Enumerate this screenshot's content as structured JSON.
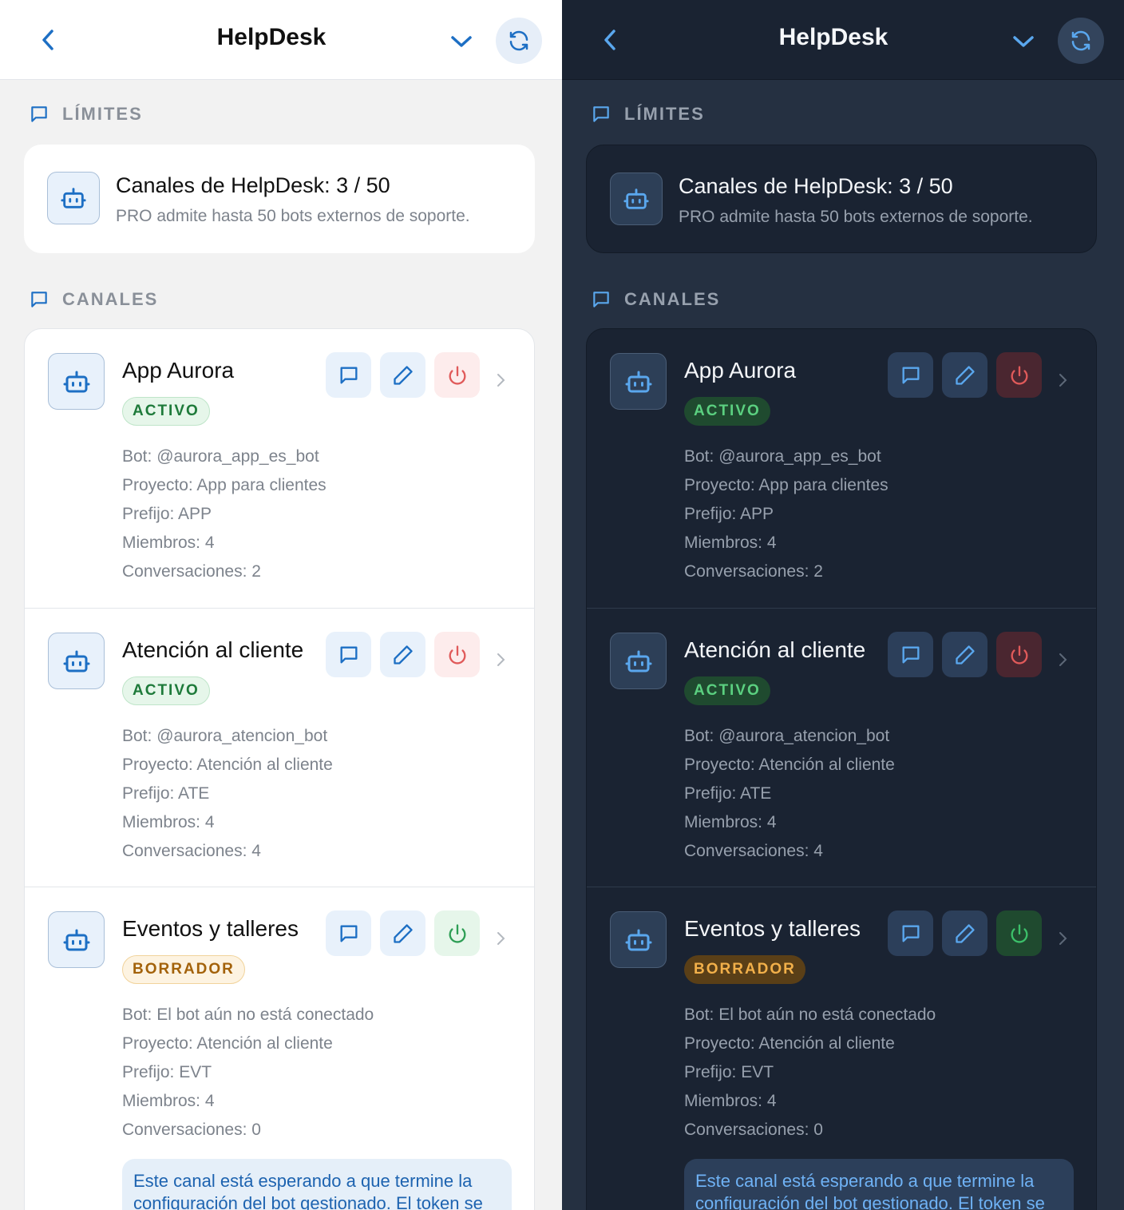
{
  "colors": {
    "accent_light": "#1d6fc4",
    "accent_dark": "#5aa7ee",
    "danger": "#e05a5a",
    "success": "#2e9e55",
    "warning": "#c47c12"
  },
  "header": {
    "title": "HelpDesk",
    "back_icon": "chevron-left-icon",
    "dropdown_icon": "chevron-down-icon",
    "refresh_icon": "refresh-icon"
  },
  "limits": {
    "section_label": "LÍMITES",
    "title": "Canales de HelpDesk: 3 / 50",
    "subtitle": "PRO admite hasta 50 bots externos de soporte."
  },
  "channels_section": {
    "label": "CANALES"
  },
  "channels": [
    {
      "name": "App Aurora",
      "status": "ACTIVO",
      "bot": "Bot: @aurora_app_es_bot",
      "project": "Proyecto: App para clientes",
      "prefix": "Prefijo: APP",
      "members": "Miembros: 4",
      "conversations": "Conversaciones: 2"
    },
    {
      "name": "Atención al cliente",
      "status": "ACTIVO",
      "bot": "Bot: @aurora_atencion_bot",
      "project": "Proyecto: Atención al cliente",
      "prefix": "Prefijo: ATE",
      "members": "Miembros: 4",
      "conversations": "Conversaciones: 4"
    },
    {
      "name": "Eventos y talleres",
      "status": "BORRADOR",
      "bot": "Bot: El bot aún no está conectado",
      "project": "Proyecto: Atención al cliente",
      "prefix": "Prefijo: EVT",
      "members": "Miembros: 4",
      "conversations": "Conversaciones: 0",
      "notice": "Este canal está esperando a que termine la configuración del bot gestionado. El token se"
    }
  ]
}
